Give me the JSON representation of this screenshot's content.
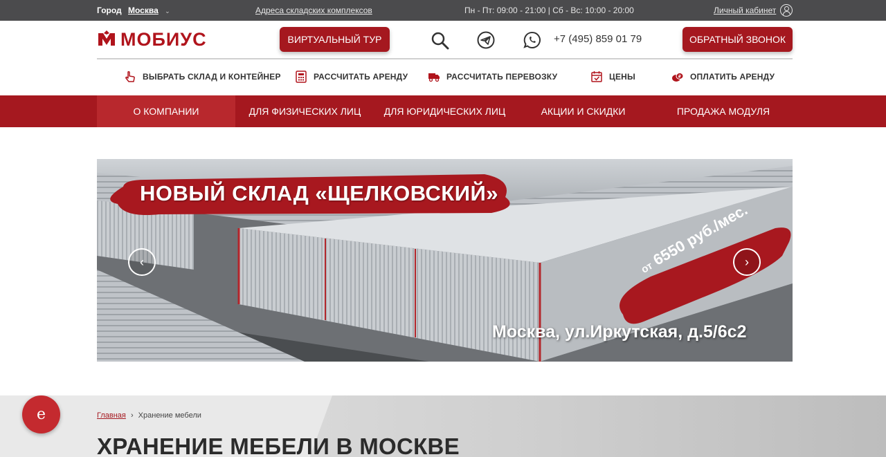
{
  "topbar": {
    "city_label": "Город",
    "city_value": "Москва",
    "warehouses_link": "Адреса складских комплексов",
    "hours": "Пн - Пт: 09:00 - 21:00 | Сб - Вс: 10:00 - 20:00",
    "cabinet": "Личный кабинет"
  },
  "header": {
    "logo_text": "МОБИУС",
    "tour_button": "ВИРТУАЛЬНЫЙ ТУР",
    "phone": "+7 (495) 859 01 79",
    "callback_button": "ОБРАТНЫЙ ЗВОНОК"
  },
  "services": [
    {
      "label": "ВЫБРАТЬ СКЛАД И КОНТЕЙНЕР",
      "icon": "pointer-hand-icon"
    },
    {
      "label": "РАССЧИТАТЬ АРЕНДУ",
      "icon": "calculator-icon"
    },
    {
      "label": "РАССЧИТАТЬ ПЕРЕВОЗКУ",
      "icon": "truck-icon"
    },
    {
      "label": "ЦЕНЫ",
      "icon": "calendar-check-icon"
    },
    {
      "label": "ОПЛАТИТЬ АРЕНДУ",
      "icon": "coins-icon"
    }
  ],
  "mainnav": [
    {
      "label": "О КОМПАНИИ",
      "active": true
    },
    {
      "label": "ДЛЯ ФИЗИЧЕСКИХ ЛИЦ",
      "active": false
    },
    {
      "label": "ДЛЯ ЮРИДИЧЕСКИХ ЛИЦ",
      "active": false
    },
    {
      "label": "АКЦИИ И СКИДКИ",
      "active": false
    },
    {
      "label": "ПРОДАЖА МОДУЛЯ",
      "active": false
    }
  ],
  "slider": {
    "title": "НОВЫЙ СКЛАД «ЩЕЛКОВСКИЙ»",
    "price_prefix": "от",
    "price": "6550 руб./мес.",
    "address": "Москва, ул.Иркутская, д.5/6с2",
    "prev": "‹",
    "next": "›"
  },
  "breadcrumb": {
    "home": "Главная",
    "separator": "›",
    "current": "Хранение мебели"
  },
  "page_title": "ХРАНЕНИЕ МЕБЕЛИ В МОСКВЕ",
  "chat_button": "e",
  "colors": {
    "brand": "#a5181f",
    "topbar": "#4b4b4d"
  }
}
